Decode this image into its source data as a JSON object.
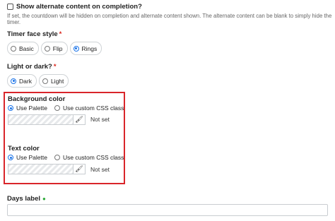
{
  "alternate": {
    "label": "Show alternate content on completion?",
    "hint": "If set, the countdown will be hidden on completion and alternate content shown. The alternate content can be blank to simply hide the timer."
  },
  "timer_face": {
    "label": "Timer face style",
    "required": "*",
    "options": [
      "Basic",
      "Flip",
      "Rings"
    ],
    "selected": "Rings"
  },
  "theme": {
    "label": "Light or dark?",
    "required": "*",
    "options": [
      "Dark",
      "Light"
    ],
    "selected": "Dark"
  },
  "background_color": {
    "label": "Background color",
    "options": [
      "Use Palette",
      "Use custom CSS class"
    ],
    "selected": "Use Palette",
    "value": "Not set"
  },
  "text_color": {
    "label": "Text color",
    "options": [
      "Use Palette",
      "Use custom CSS class"
    ],
    "selected": "Use Palette",
    "value": "Not set"
  },
  "days": {
    "label": "Days label",
    "value": ""
  },
  "colors": {
    "accent": "#1a73e8",
    "highlight_box": "#d9252a",
    "required": "#d9251b",
    "chat_icon": "#2eaa3b"
  }
}
